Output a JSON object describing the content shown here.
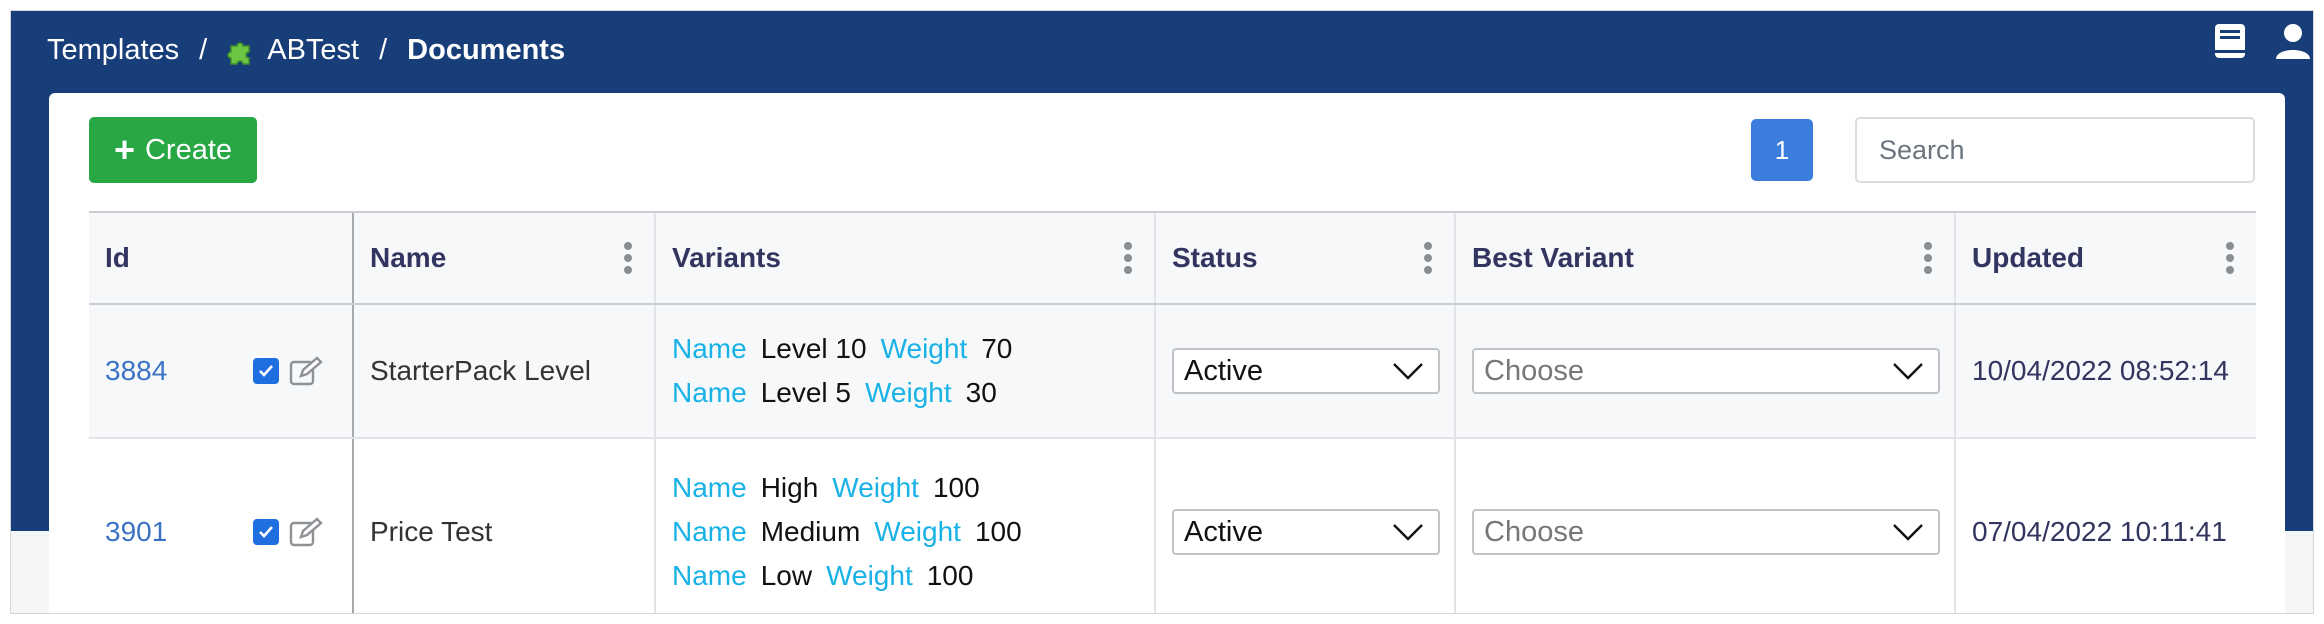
{
  "breadcrumb": {
    "items": [
      "Templates",
      "ABTest",
      "Documents"
    ],
    "separator": "/"
  },
  "header_icons": [
    "book-icon",
    "user-icon"
  ],
  "toolbar": {
    "create_label": "Create",
    "page_number": "1",
    "search_placeholder": "Search"
  },
  "table": {
    "columns": [
      "Id",
      "Name",
      "Variants",
      "Status",
      "Best Variant",
      "Updated"
    ],
    "variant_keys": {
      "name": "Name",
      "weight": "Weight"
    },
    "rows": [
      {
        "id": "3884",
        "name": "StarterPack Level",
        "variants": [
          {
            "name": "Level 10",
            "weight": "70"
          },
          {
            "name": "Level 5",
            "weight": "30"
          }
        ],
        "status": "Active",
        "best_variant": "Choose",
        "updated": "10/04/2022 08:52:14",
        "checked": true
      },
      {
        "id": "3901",
        "name": "Price Test",
        "variants": [
          {
            "name": "High",
            "weight": "100"
          },
          {
            "name": "Medium",
            "weight": "100"
          },
          {
            "name": "Low",
            "weight": "100"
          }
        ],
        "status": "Active",
        "best_variant": "Choose",
        "updated": "07/04/2022 10:11:41",
        "checked": true
      }
    ]
  },
  "colors": {
    "header_bg": "#173e79",
    "create_green": "#28a745",
    "page_blue": "#3b7ddd",
    "variant_key": "#18b2e6",
    "id_link": "#3b73c4"
  }
}
